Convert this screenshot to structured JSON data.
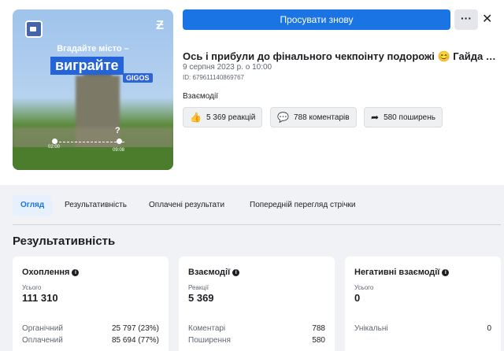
{
  "thumbnail": {
    "headline_line1": "Вгадайте місто –",
    "headline_line2": "виграйте",
    "brand": "GIGOS",
    "time_start": "02:00",
    "time_end": "09:08",
    "question": "?"
  },
  "actions": {
    "promote_label": "Просувати знову",
    "more_label": "···",
    "close_label": "✕"
  },
  "post": {
    "title": "Ось і прибули до фінального чекпоінту подорожі 😊 Гайда з …",
    "date": "9 серпня 2023 р. о 10:00",
    "id": "ID: 679611140869767"
  },
  "engagement": {
    "label": "Взаємодії",
    "reactions": "5 369 реакцій",
    "comments": "788 коментарів",
    "shares": "580 поширень"
  },
  "tabs": [
    {
      "label": "Огляд",
      "active": true
    },
    {
      "label": "Результативність",
      "active": false
    },
    {
      "label": "Оплачені результати",
      "active": false
    },
    {
      "label": "Попередній перегляд стрічки",
      "active": false
    }
  ],
  "section_title": "Результативність",
  "cards": {
    "reach": {
      "title": "Охоплення",
      "sub": "Усього",
      "value": "111 310",
      "rows": [
        {
          "label": "Органічний",
          "value": "25 797 (23%)"
        },
        {
          "label": "Оплачений",
          "value": "85 694 (77%)"
        }
      ]
    },
    "interactions": {
      "title": "Взаємодії",
      "sub": "Реакції",
      "value": "5 369",
      "rows": [
        {
          "label": "Коментарі",
          "value": "788"
        },
        {
          "label": "Поширення",
          "value": "580"
        }
      ]
    },
    "negative": {
      "title": "Негативні взаємодії",
      "sub": "Усього",
      "value": "0",
      "rows": [
        {
          "label": "Унікальні",
          "value": "0"
        }
      ]
    }
  },
  "colors": {
    "accent": "#1b74e4",
    "page_bg": "#f0f2f5",
    "card_bg": "#ffffff",
    "muted_text": "#606770"
  }
}
